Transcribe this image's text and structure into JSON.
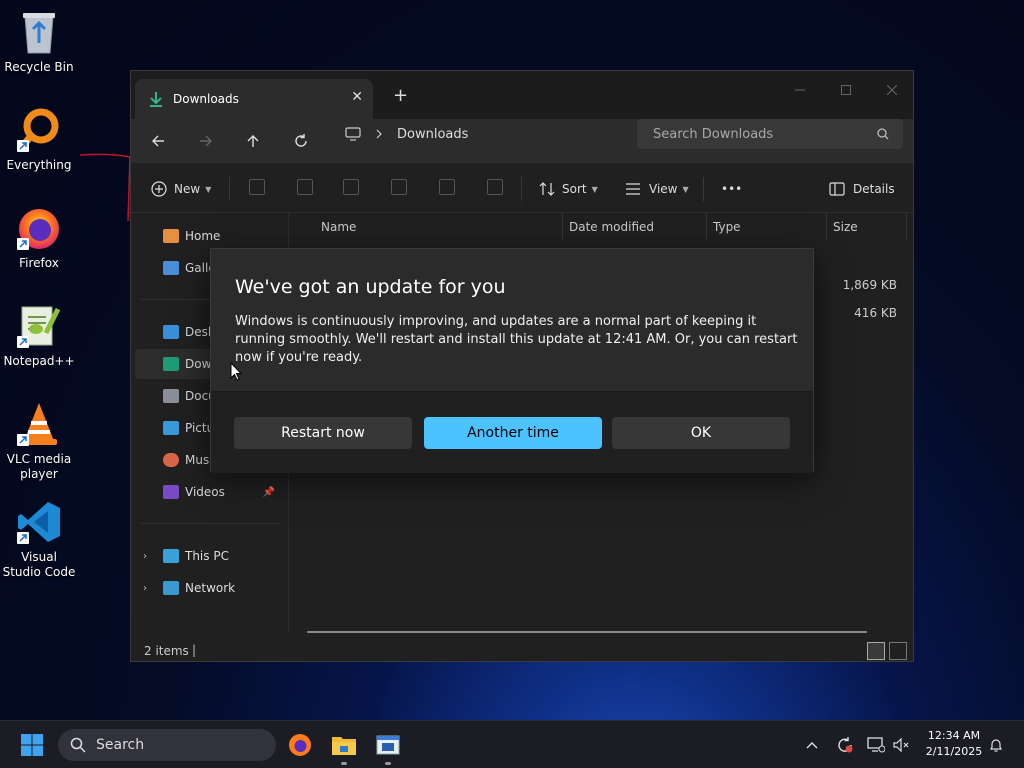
{
  "desktop": {
    "icons": [
      {
        "label": "Recycle Bin"
      },
      {
        "label": "Everything"
      },
      {
        "label": "Firefox"
      },
      {
        "label": "Notepad++"
      },
      {
        "label": "VLC media player"
      },
      {
        "label": "Visual Studio Code"
      }
    ]
  },
  "explorer": {
    "tab_title": "Downloads",
    "tab_close": "✕",
    "new_tab": "+",
    "address": "Downloads",
    "search_placeholder": "Search Downloads",
    "commands": {
      "new": "New",
      "sort": "Sort",
      "view": "View",
      "more": "•••",
      "details": "Details"
    },
    "sidebar": {
      "items": [
        {
          "label": "Home"
        },
        {
          "label": "Galle"
        },
        {
          "label": "Desk"
        },
        {
          "label": "Dow"
        },
        {
          "label": "Docu"
        },
        {
          "label": "Pictu"
        },
        {
          "label": "Musi"
        },
        {
          "label": "Videos"
        },
        {
          "label": "This PC"
        },
        {
          "label": "Network"
        }
      ]
    },
    "columns": [
      "Name",
      "Date modified",
      "Type",
      "Size"
    ],
    "file_sizes": [
      "1,869 KB",
      "416 KB"
    ],
    "status": "2 items"
  },
  "dialog": {
    "title": "We've got an update for you",
    "text": "Windows is continuously improving, and updates are a normal part of keeping it running smoothly. We'll restart and install this update at 12:41 AM. Or, you can restart now if you're ready.",
    "buttons": {
      "restart": "Restart now",
      "another": "Another time",
      "ok": "OK"
    },
    "accent": "#4cc2ff"
  },
  "taskbar": {
    "search": "Search",
    "time": "12:34 AM",
    "date": "2/11/2025"
  }
}
